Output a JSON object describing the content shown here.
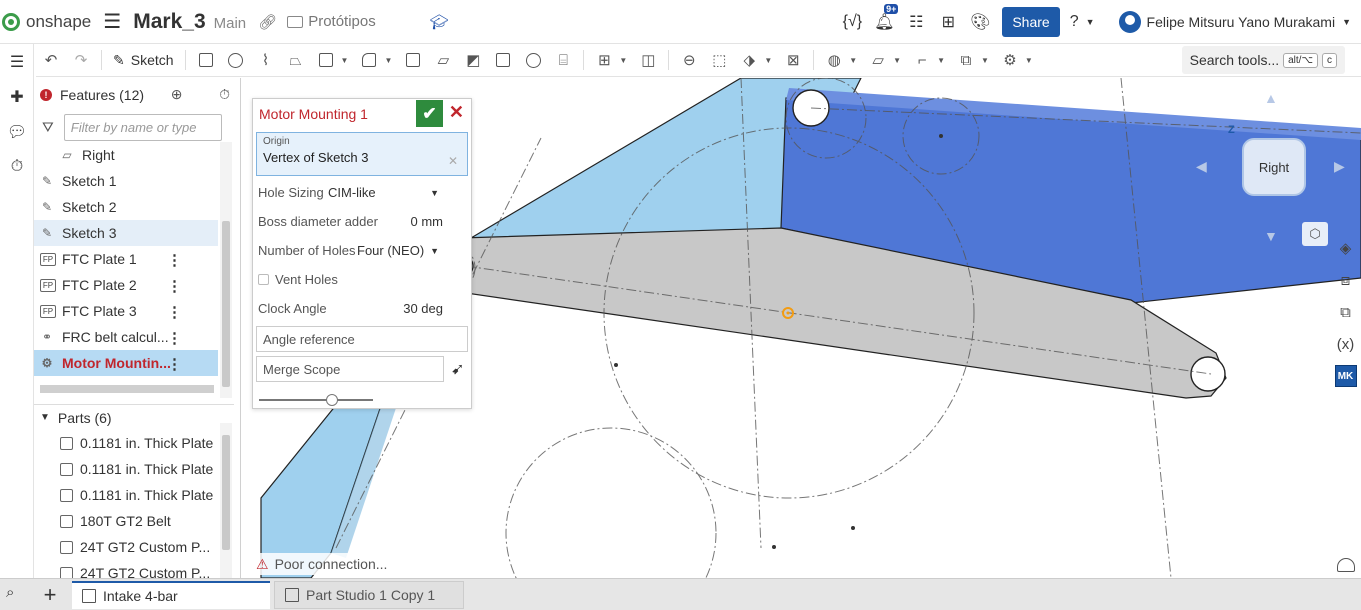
{
  "header": {
    "app_name": "onshape",
    "document_name": "Mark_3",
    "branch": "Main",
    "folder": "Protótipos",
    "notification_count": "9+",
    "share_label": "Share",
    "user_name": "Felipe Mitsuru Yano Murakami"
  },
  "toolbar": {
    "sketch_label": "Sketch",
    "search_label": "Search tools...",
    "search_shortcut_1": "alt/⌥",
    "search_shortcut_2": "c"
  },
  "features_panel": {
    "title": "Features (12)",
    "filter_placeholder": "Filter by name or type",
    "items": [
      {
        "label": "Right",
        "icon": "plane-icon"
      },
      {
        "label": "Sketch 1",
        "icon": "sketch-icon"
      },
      {
        "label": "Sketch 2",
        "icon": "sketch-icon"
      },
      {
        "label": "Sketch 3",
        "icon": "sketch-icon"
      },
      {
        "label": "FTC Plate 1",
        "icon": "fp-icon"
      },
      {
        "label": "FTC Plate 2",
        "icon": "fp-icon"
      },
      {
        "label": "FTC Plate 3",
        "icon": "fp-icon"
      },
      {
        "label": "FRC belt calcul...",
        "icon": "belt-icon"
      },
      {
        "label": "Motor Mountin...",
        "icon": "motor-icon"
      }
    ],
    "fp_badge": "FP",
    "parts_header": "Parts (6)",
    "parts": [
      "0.1181 in. Thick Plate",
      "0.1181 in. Thick Plate",
      "0.1181 in. Thick Plate",
      "180T GT2 Belt",
      "24T GT2 Custom P...",
      "24T GT2 Custom P..."
    ]
  },
  "dialog": {
    "title": "Motor Mounting 1",
    "origin_label": "Origin",
    "origin_value": "Vertex of Sketch 3",
    "hole_sizing_label": "Hole Sizing",
    "hole_sizing_value": "CIM-like",
    "boss_label": "Boss diameter adder",
    "boss_value": "0 mm",
    "holes_label": "Number of Holes",
    "holes_value": "Four (NEO)",
    "vent_label": "Vent Holes",
    "clock_label": "Clock Angle",
    "clock_value": "30 deg",
    "angle_ref_label": "Angle reference",
    "merge_label": "Merge Scope",
    "slider_level": 0.64
  },
  "viewcube": {
    "face_label": "Right",
    "axis_label": "Z"
  },
  "right_rail": {
    "mk_label": "MK"
  },
  "status": {
    "connection": "Poor connection..."
  },
  "tabs": [
    {
      "label": "Intake 4-bar"
    },
    {
      "label": "Part Studio 1 Copy 1"
    }
  ],
  "colors": {
    "accent": "#1e5aa8",
    "error_red": "#c0262d",
    "ok_green": "#2e8b3d",
    "plate_blue": "#4f77d6",
    "plate_light": "#9fd0ee",
    "plate_grey": "#c8c8c8"
  }
}
